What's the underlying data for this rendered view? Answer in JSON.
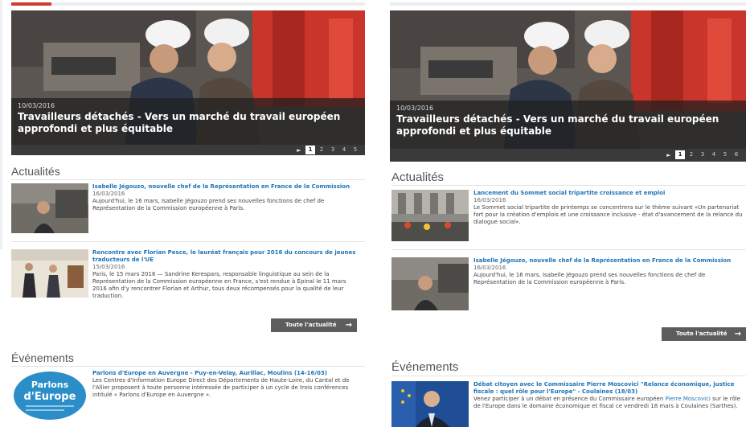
{
  "left": {
    "slider": {
      "date": "10/03/2016",
      "title": "Travailleurs détachés - Vers un marché du travail européen approfondi et plus équitable",
      "play": "►",
      "pages": [
        "1",
        "2",
        "3",
        "4",
        "5"
      ],
      "active_page": "1"
    },
    "news": {
      "heading": "Actualités",
      "items": [
        {
          "title": "Isabelle Jégouzo, nouvelle chef de la Représentation en France de la Commission",
          "date": "16/03/2016",
          "body": "Aujourd'hui, le 16 mars, Isabelle Jégouzo prend ses nouvelles fonctions de chef de Représentation de la Commission européenne à Paris."
        },
        {
          "title": "Rencontre avec Florian Pesce, le lauréat français pour 2016 du concours de jeunes traducteurs de l'UE",
          "date": "15/03/2016",
          "body": "Paris, le 15 mars 2016 — Sandrine Kerespars, responsable linguistique au sein de la Représentation de la Commission européenne en France, s'est rendue à Épinal le 11 mars 2016 afin d'y rencontrer Florian et Arthur, tous deux récompensés pour la qualité de leur traduction."
        }
      ],
      "all_label": "Toute l'actualité",
      "all_arrow": "→"
    },
    "events": {
      "heading": "Événements",
      "items": [
        {
          "logo_line1": "Parlons",
          "logo_line2": "d'Europe",
          "title": "Parlons d'Europe en Auvergne - Puy-en-Velay, Aurillac, Moulins (14-16/03)",
          "body": "Les Centres d'Information Europe Direct des Départements de Haute-Loire, du Cantal et de l'Allier proposent à toute personne intéressée de participer à un cycle de trois conférences intitulé « Parlons d'Europe en Auvergne »."
        }
      ]
    }
  },
  "right": {
    "slider": {
      "date": "10/03/2016",
      "title": "Travailleurs détachés - Vers un marché du travail européen approfondi et plus équitable",
      "play": "►",
      "pages": [
        "1",
        "2",
        "3",
        "4",
        "5",
        "6"
      ],
      "active_page": "1"
    },
    "news": {
      "heading": "Actualités",
      "items": [
        {
          "title": "Lancement du Sommet social tripartite croissance et emploi",
          "date": "16/03/2016",
          "body": "Le Sommet social tripartite de printemps se concentrera sur le thème suivant «Un partenariat fort pour la création d'emplois et une croissance inclusive - état d'avancement de la relance du dialogue social»."
        },
        {
          "title": "Isabelle Jégouzo, nouvelle chef de la Représentation en France de la Commission",
          "date": "16/03/2016",
          "body": "Aujourd'hui, le 16 mars, Isabelle Jégouzo prend ses nouvelles fonctions de chef de Représentation de la Commission européenne à Paris."
        }
      ],
      "all_label": "Toute l'actualité",
      "all_arrow": "→"
    },
    "events": {
      "heading": "Événements",
      "items": [
        {
          "title": "Débat citoyen avec le Commissaire Pierre Moscovici \"Relance économique, justice fiscale : quel rôle pour l'Europe\" - Coulaines (18/03)",
          "body_start": "Venez participer à un débat en présence du Commissaire européen ",
          "body_link": "Pierre Moscovici",
          "body_end": " sur le rôle de l'Europe dans le domaine économique et fiscal ce vendredi 18 mars à Coulaines (Sarthes)."
        }
      ]
    }
  },
  "colors": {
    "accent_red": "#d23a2a",
    "link_blue": "#1d74b8",
    "button_gray": "#5d5d5d"
  }
}
